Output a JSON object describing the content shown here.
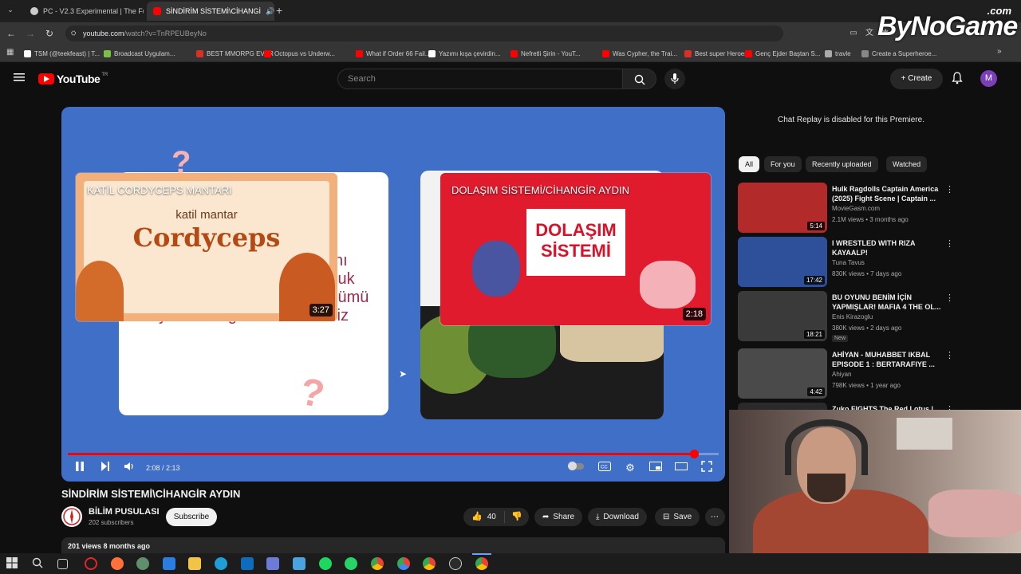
{
  "browser": {
    "tabs": [
      {
        "label": "PC - V2.3 Experimental | The Fu",
        "active": false,
        "favicon_color": "#cccccc"
      },
      {
        "label": "SİNDİRİM SİSTEMİ\\CİHANGİ",
        "active": true,
        "favicon_color": "#ff0000"
      }
    ],
    "url_host": "youtube.com",
    "url_path": "/watch?v=TnRPEUBeyNo",
    "bookmarks": [
      {
        "label": "TSM (@teekfeast) | T...",
        "color": "#ffffff"
      },
      {
        "label": "Broadcast Uygulam...",
        "color": "#7bc043"
      },
      {
        "label": "BEST MMORPG EVER",
        "color": "#d93025"
      },
      {
        "label": "Octopus vs Underw...",
        "color": "#ff0000"
      },
      {
        "label": "What if Order 66 Fail...",
        "color": "#ff0000"
      },
      {
        "label": "Yazımı kışa çevirdin...",
        "color": "#ffffff"
      },
      {
        "label": "Nefretli Şirin - YouT...",
        "color": "#ff0000"
      },
      {
        "label": "Was Cypher, the Trai...",
        "color": "#ff0000"
      },
      {
        "label": "Best super Heroes",
        "color": "#d93025"
      },
      {
        "label": "Genç Ejder Baştan S...",
        "color": "#ff0000"
      },
      {
        "label": "travle",
        "color": "#aaaaaa"
      },
      {
        "label": "Create a Superheroe...",
        "color": "#888888"
      }
    ]
  },
  "watermark": {
    "brand": "ByNoGame",
    "suffix": ".com"
  },
  "youtube": {
    "logo_text": "YouTube",
    "logo_region": "TR",
    "search_placeholder": "Search",
    "create_label": "Create",
    "avatar_letter": "M"
  },
  "video": {
    "endscreen_left": {
      "title": "KATİL CORDYCEPS MANTARI",
      "duration": "3:27",
      "line1": "katil mantar",
      "line2": "Cordyceps"
    },
    "endscreen_right": {
      "title": "DOLAŞIM SİSTEMİ/CİHANGİR AYDIN",
      "duration": "2:18",
      "line1": "DOLAŞIM",
      "line2": "SİSTEMİ"
    },
    "slide_text": [
      "nı",
      "luk",
      "lümü",
      "yakından görmek isterdiniz"
    ],
    "timecode": "2:08 / 2:13",
    "progress": 0.9624
  },
  "meta": {
    "title": "SİNDİRİM SİSTEMİ\\CİHANGİR AYDIN",
    "channel": "BİLİM PUSULASI",
    "subscribers": "202 subscribers",
    "subscribe_label": "Subscribe",
    "likes": "40",
    "share_label": "Share",
    "download_label": "Download",
    "save_label": "Save",
    "views_line": "201 views  8 months ago"
  },
  "sidebar": {
    "chat_replay": "Chat Replay is disabled for this Premiere.",
    "chips": [
      "All",
      "For you",
      "Recently uploaded",
      "Watched"
    ],
    "recommendations": [
      {
        "title": "Hulk Ragdolls Captain America (2025) Fight Scene | Captain ...",
        "channel": "MovieGasm.com",
        "views": "2.1M views • 3 months ago",
        "duration": "5:14",
        "badge": "",
        "thumb_color": "#b22a2a"
      },
      {
        "title": "I WRESTLED WITH RIZA KAYAALP!",
        "channel": "Tuna Tavus",
        "views": "830K views • 7 days ago",
        "duration": "17:42",
        "badge": "",
        "thumb_color": "#2e4f9a"
      },
      {
        "title": "BU OYUNU BENİM İÇİN YAPMIŞLAR! MAFIA 4 THE OL...",
        "channel": "Enis Kirazoglu",
        "views": "380K views • 2 days ago",
        "duration": "18:21",
        "badge": "New",
        "thumb_color": "#3a3a3a"
      },
      {
        "title": "AHİYAN - MUHABBET IKBAL EPISODE 1 : BERTARAFIYE ...",
        "channel": "Ahiyan",
        "views": "798K views • 1 year ago",
        "duration": "4:42",
        "badge": "",
        "thumb_color": "#4a4a4a"
      },
      {
        "title": "Zuko FIGHTS The Red Lotus |",
        "channel": "",
        "views": "",
        "duration": "",
        "badge": "",
        "thumb_color": "#2a2a2a"
      }
    ]
  }
}
